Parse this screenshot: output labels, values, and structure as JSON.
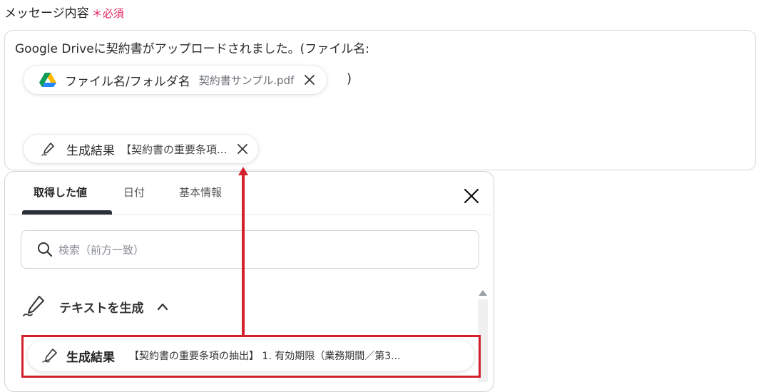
{
  "field": {
    "label": "メッセージ内容",
    "required_mark": "＊",
    "required_text": "必須"
  },
  "editor": {
    "text_line": "Google Driveに契約書がアップロードされました。(ファイル名:",
    "close_paren": ")",
    "chip_file": {
      "icon": "google-drive-icon",
      "label": "ファイル名/フォルダ名",
      "value": "契約書サンプル.pdf"
    },
    "chip_result": {
      "icon": "pen-icon",
      "label": "生成結果",
      "value": "【契約書の重要条項..."
    }
  },
  "panel": {
    "tabs": [
      {
        "label": "取得した値",
        "active": true
      },
      {
        "label": "日付",
        "active": false
      },
      {
        "label": "基本情報",
        "active": false
      }
    ],
    "search": {
      "placeholder": "検索（前方一致）"
    },
    "group": {
      "icon": "pen-icon",
      "title": "テキストを生成",
      "expanded": true
    },
    "item": {
      "label": "生成結果",
      "value": "【契約書の重要条項の抽出】 1. 有効期限（業務期間／第3..."
    }
  },
  "colors": {
    "accent_red": "#d4202c",
    "required_pink": "#e0245e",
    "tab_underline": "#2b2f36"
  }
}
